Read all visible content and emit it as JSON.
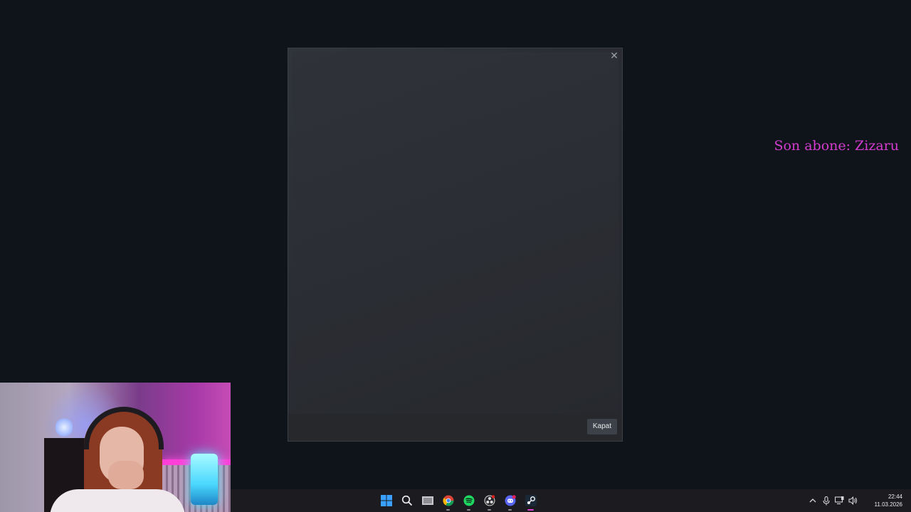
{
  "dialog": {
    "close_glyph": "✕",
    "close_button_label": "Kapat"
  },
  "overlay": {
    "last_subscriber": "Son abone: Zizaru",
    "color": "#d43ccf"
  },
  "taskbar": {
    "apps": [
      {
        "name": "start-menu",
        "icon": "windows-logo-icon"
      },
      {
        "name": "search",
        "icon": "search-icon"
      },
      {
        "name": "file-explorer",
        "icon": "folder-icon"
      },
      {
        "name": "chrome",
        "icon": "chrome-icon"
      },
      {
        "name": "spotify",
        "icon": "spotify-icon"
      },
      {
        "name": "obs",
        "icon": "obs-icon"
      },
      {
        "name": "discord",
        "icon": "discord-icon"
      },
      {
        "name": "steam",
        "icon": "steam-icon"
      }
    ],
    "tray": {
      "chevron": "^",
      "mic": "microphone-icon",
      "network": "network-icon",
      "volume": "speaker-icon"
    },
    "clock": {
      "time": "22:44",
      "date": "11.03.2026"
    },
    "accent": "#d93fd0"
  }
}
